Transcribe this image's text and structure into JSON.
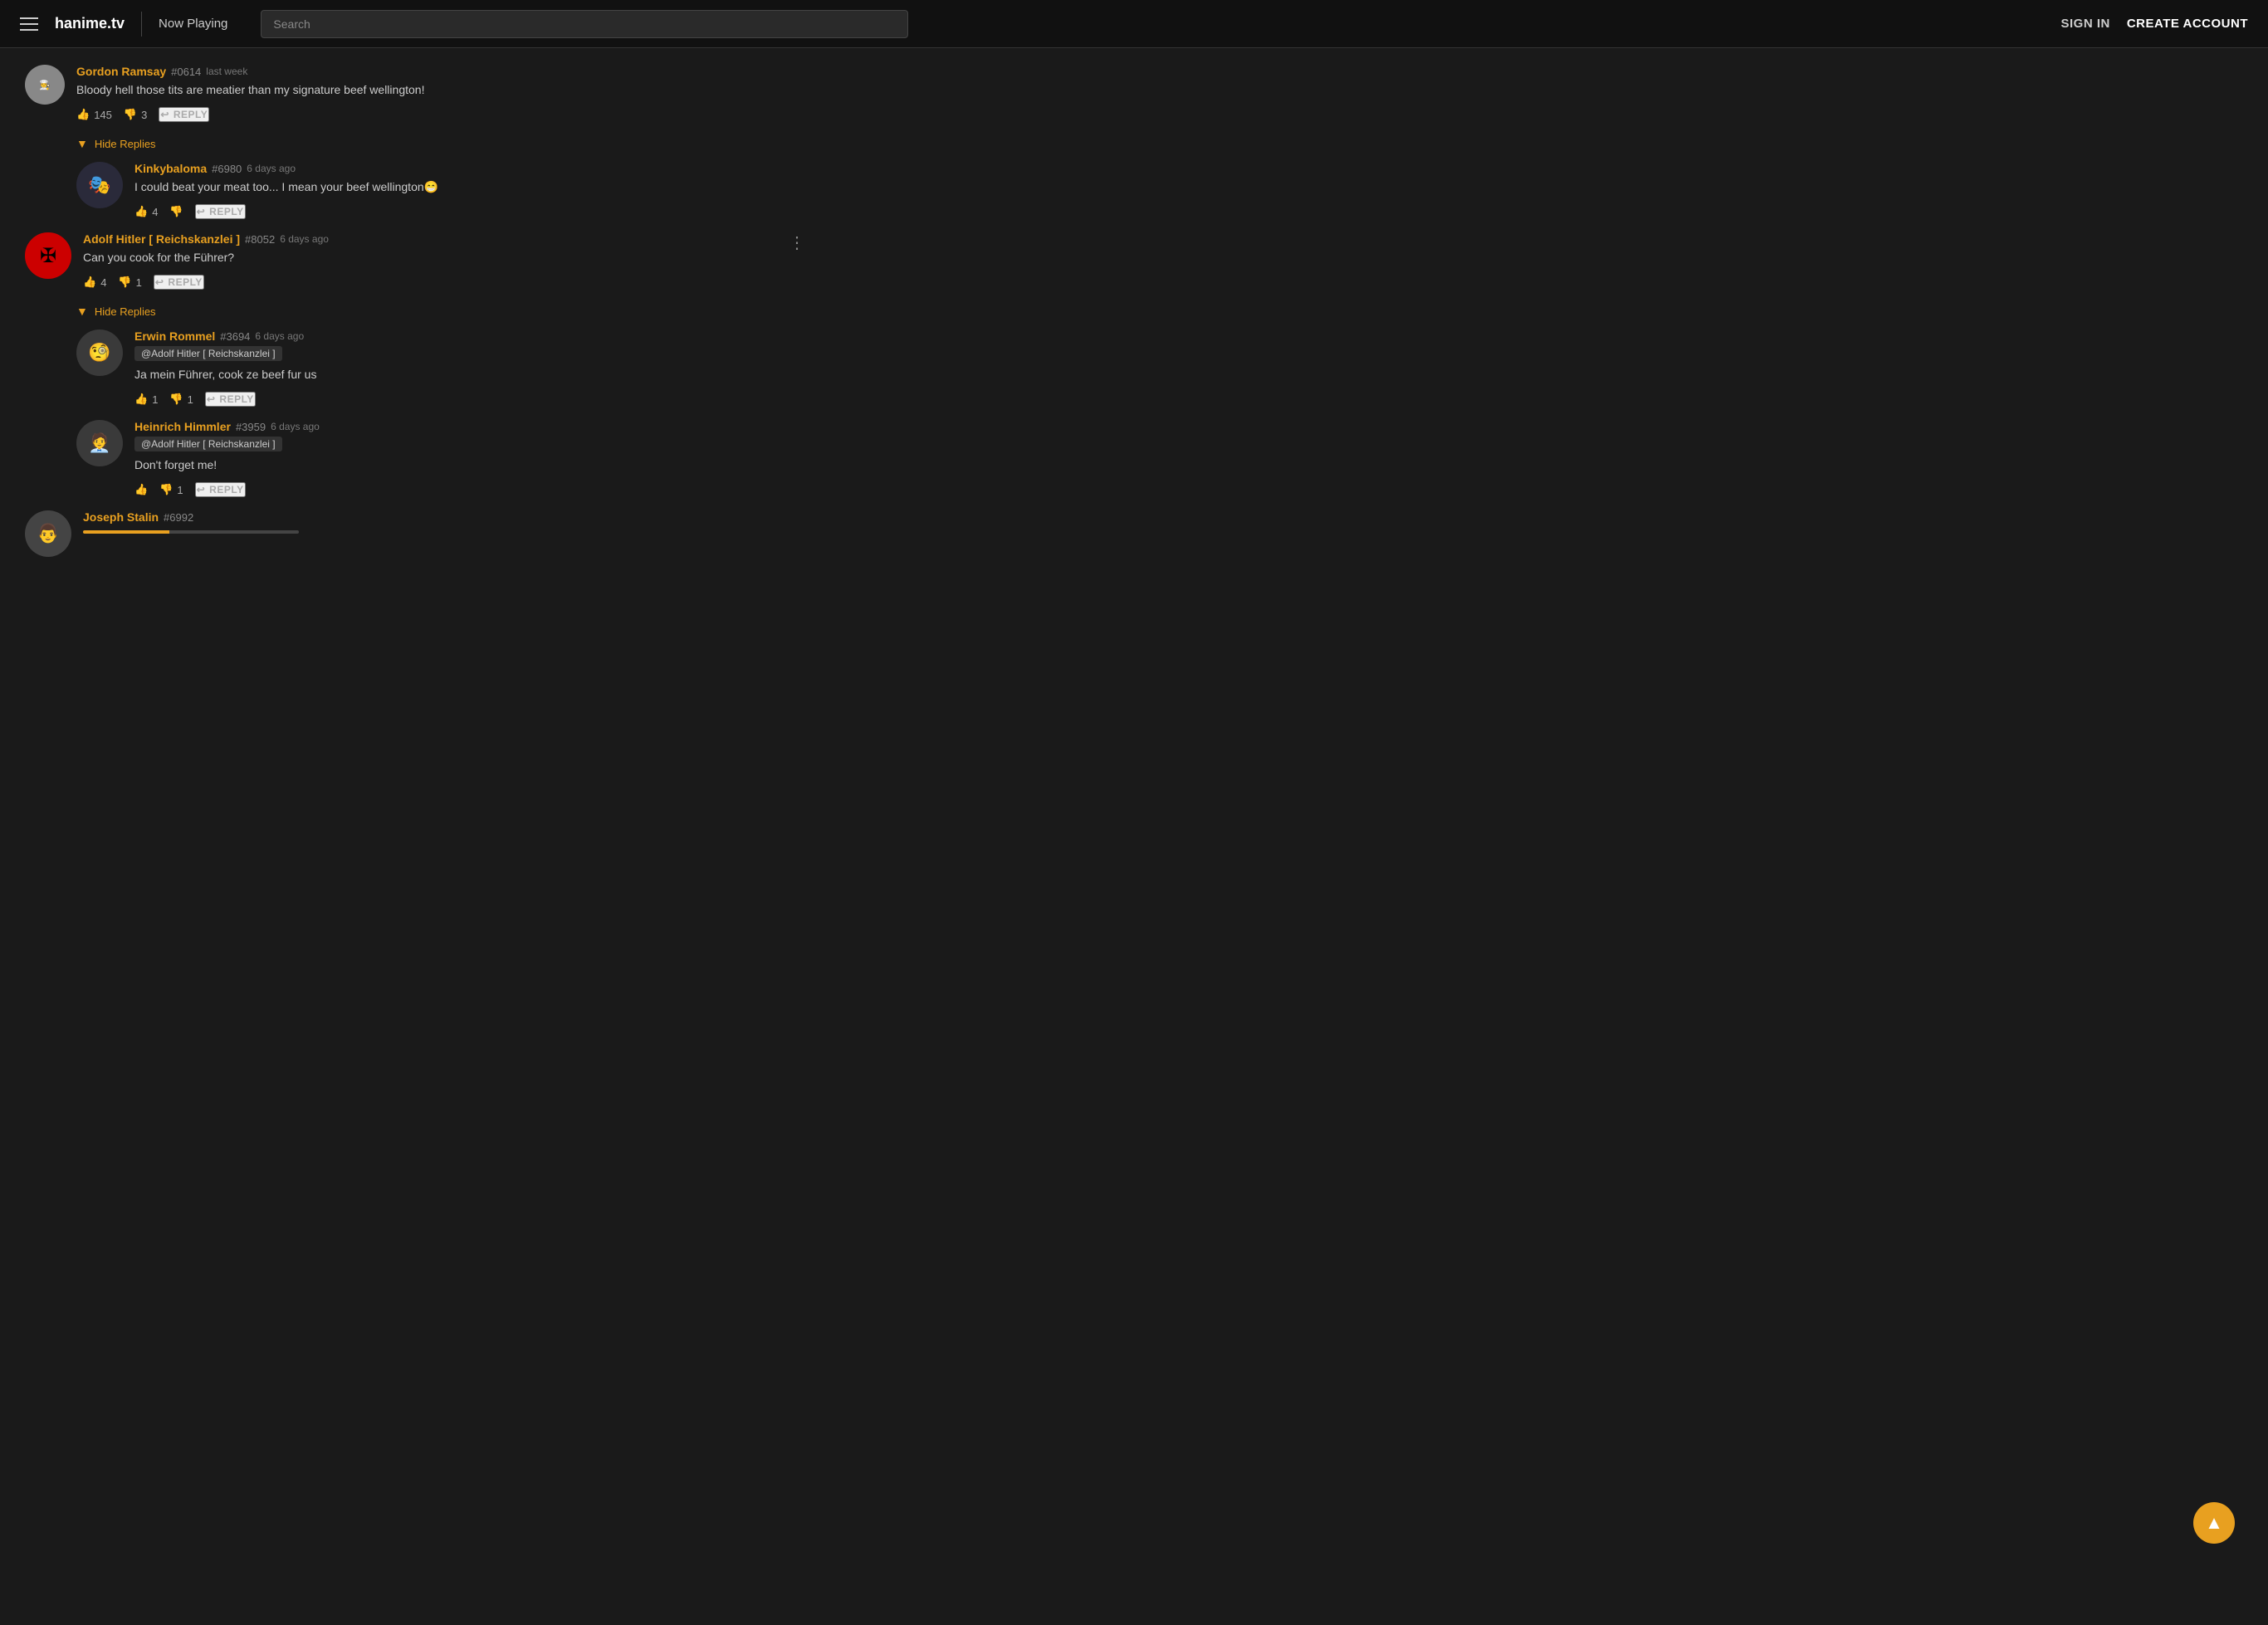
{
  "nav": {
    "logo": "hanime.tv",
    "now_playing": "Now Playing",
    "search_placeholder": "Search",
    "sign_in": "SIGN IN",
    "create_account": "CREATE ACCOUNT"
  },
  "comments": [
    {
      "id": "gordon",
      "username": "Gordon Ramsay",
      "user_num": "#0614",
      "time": "last week",
      "text": "Bloody hell those tits are meatier than my signature beef wellington!",
      "likes": 145,
      "dislikes": 3,
      "has_replies": true,
      "replies_label": "Hide Replies",
      "replies": [
        {
          "id": "kinky",
          "username": "Kinkybaloma",
          "user_num": "#6980",
          "time": "6 days ago",
          "text": "I could beat your meat too... I mean your beef wellington😁",
          "likes": 4,
          "dislikes": 0
        }
      ]
    },
    {
      "id": "adolf",
      "username": "Adolf Hitler [ Reichskanzlei ]",
      "user_num": "#8052",
      "time": "6 days ago",
      "text": "Can you cook for the Führer?",
      "likes": 4,
      "dislikes": 1,
      "has_replies": true,
      "replies_label": "Hide Replies",
      "replies": [
        {
          "id": "rommel",
          "username": "Erwin Rommel",
          "user_num": "#3694",
          "time": "6 days ago",
          "mention": "@Adolf Hitler [ Reichskanzlei ]",
          "text": "Ja mein Führer, cook ze beef fur us",
          "likes": 1,
          "dislikes": 1
        },
        {
          "id": "himmler",
          "username": "Heinrich Himmler",
          "user_num": "#3959",
          "time": "6 days ago",
          "mention": "@Adolf Hitler [ Reichskanzlei ]",
          "text": "Don't forget me!",
          "likes": 0,
          "dislikes": 1
        }
      ]
    },
    {
      "id": "stalin",
      "username": "Joseph Stalin",
      "user_num": "#6992",
      "time": "",
      "text": "",
      "likes": 0,
      "dislikes": 0
    }
  ],
  "labels": {
    "reply": "REPLY",
    "hide_replies": "Hide Replies"
  }
}
